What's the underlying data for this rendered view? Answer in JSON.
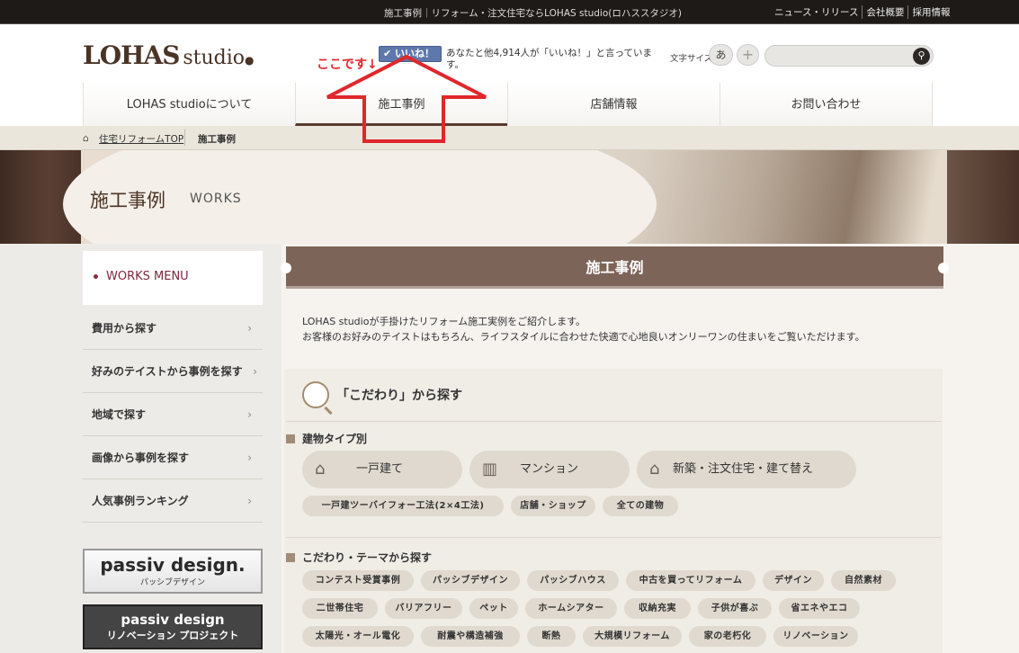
{
  "topbar": {
    "title": "施工事例｜リフォーム・注文住宅ならLOHAS studio(ロハススタジオ)",
    "links": [
      "ニュース・リリース",
      "会社概要",
      "採用情報"
    ]
  },
  "header": {
    "logo_main": "LOHAS",
    "logo_sub": "studio",
    "annotation": "ここです↓",
    "like_label": "✔ いいね！",
    "like_text": "あなたと他4,914人が「いいね！」と言っています。",
    "font_size_label": "文字サイズ",
    "font_size_small": "あ",
    "font_size_plus": "+",
    "search_placeholder": ""
  },
  "nav": {
    "items": [
      "LOHAS studioについて",
      "施工事例",
      "店舗情報",
      "お問い合わせ"
    ]
  },
  "breadcrumb": {
    "home": "住宅リフォームTOP",
    "current": "施工事例"
  },
  "hero": {
    "title": "施工事例",
    "subtitle": "WORKS"
  },
  "sidebar": {
    "menu_title": "WORKS MENU",
    "items": [
      "費用から探す",
      "好みのテイストから事例を探す",
      "地域で探す",
      "画像から事例を探す",
      "人気事例ランキング"
    ],
    "banner1_title": "passiv design.",
    "banner1_sub": "パッシブデザイン",
    "banner2_title": "passiv design",
    "banner2_sub": "リノベーション プロジェクト"
  },
  "main": {
    "ribbon_title": "施工事例",
    "intro_line1": "LOHAS studioが手掛けたリフォーム施工実例をご紹介します。",
    "intro_line2": "お客様のお好みのテイストはもちろん、ライフスタイルに合わせた快適で心地良いオンリーワンの住まいをご覧いただけます。",
    "kodawari_title": "「こだわり」から探す",
    "building_heading": "建物タイプ別",
    "building_buttons": [
      "一戸建て",
      "マンション",
      "新築・注文住宅・建て替え"
    ],
    "building_tags": [
      "一戸建ツーバイフォー工法(2×4工法)",
      "店舗・ショップ",
      "全ての建物"
    ],
    "theme_heading": "こだわり・テーマから探す",
    "theme_tags_row1": [
      "コンテスト受賞事例",
      "パッシブデザイン",
      "パッシブハウス",
      "中古を買ってリフォーム",
      "デザイン",
      "自然素材"
    ],
    "theme_tags_row2": [
      "二世帯住宅",
      "バリアフリー",
      "ペット",
      "ホームシアター",
      "収納充実",
      "子供が喜ぶ",
      "省エネやエコ"
    ],
    "theme_tags_row3": [
      "太陽光・オール電化",
      "耐震や構造補強",
      "断熱",
      "大規模リフォーム",
      "家の老朽化",
      "リノベーション"
    ]
  }
}
